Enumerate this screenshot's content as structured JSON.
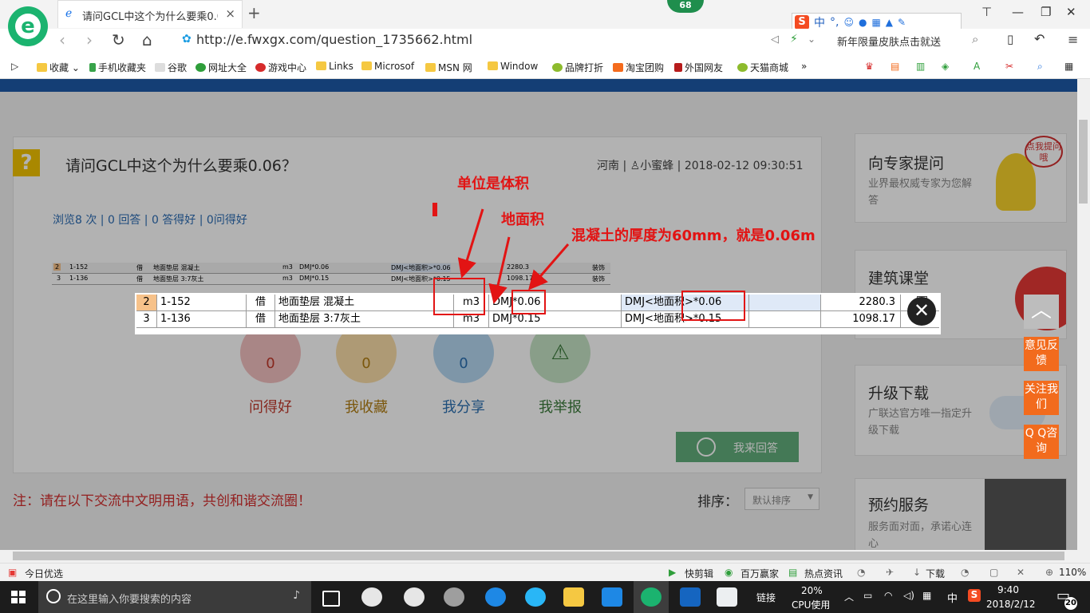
{
  "browser": {
    "tab_title": "请问GCL中这个为什么要乘0.06？",
    "tab_close": "×",
    "new_tab": "+",
    "badge": "68",
    "url": "http://e.fwxgx.com/question_1735662.html",
    "promo": "新年限量皮肤点击就送",
    "sogou_labels": [
      "中",
      "°,"
    ],
    "bookmarks": [
      "收藏",
      "手机收藏夹",
      "谷歌",
      "网址大全",
      "游戏中心",
      "Links",
      "Microsof",
      "MSN 网",
      "Window",
      "品牌打折",
      "淘宝团购",
      "外国网友",
      "天猫商城"
    ],
    "more": "»"
  },
  "question": {
    "title": "请问GCL中这个为什么要乘0.06？",
    "region": "河南",
    "user": "小蜜蜂",
    "date": "2018-02-12 09:30:51",
    "stats": "浏览8 次 | 0 回答 | 0 答得好 | 0问得好",
    "actions": [
      {
        "count": "0",
        "label": "问得好",
        "color": "#e57373"
      },
      {
        "count": "0",
        "label": "我收藏",
        "color": "#f2b33d"
      },
      {
        "count": "0",
        "label": "我分享",
        "color": "#5aa7e0"
      },
      {
        "count": "",
        "label": "我举报",
        "color": "#7fbf7f"
      }
    ],
    "answer_button": "我来回答",
    "notice": "注：请在以下交流中文明用语，共创和谐交流圈！",
    "sort_label": "排序：",
    "sort_value": "默认排序"
  },
  "sidebar": {
    "cards": [
      {
        "title": "向专家提问",
        "sub": "业界最权威专家为您解答"
      },
      {
        "title": "建筑课堂",
        "sub": ""
      },
      {
        "title": "升级下载",
        "sub": "广联达官方唯一指定升级下载"
      },
      {
        "title": "预约服务",
        "sub": "服务面对面，承诺心连心"
      }
    ],
    "bubble": "点我提问哦",
    "feedback": "意见反馈",
    "follow": "关注我们",
    "qq": "Q Q咨询"
  },
  "table_rows": [
    {
      "no": "2",
      "code": "1-152",
      "type": "借",
      "name": "地面垫层 混凝土",
      "unit": "m3",
      "formula": "DMJ*0.06",
      "expr": "DMJ<地面积>*0.06",
      "qty": "2280.3"
    },
    {
      "no": "3",
      "code": "1-136",
      "type": "借",
      "name": "地面垫层 3:7灰土",
      "unit": "m3",
      "formula": "DMJ*0.15",
      "expr": "DMJ<地面积>*0.15",
      "qty": "1098.17"
    }
  ],
  "small_rows": [
    {
      "no": "2",
      "code": "1-152",
      "type": "借",
      "name": "地面垫层 混凝土",
      "unit": "m3",
      "formula": "DMJ*0.06",
      "expr": "DMJ<地面积>*0.06",
      "qty": "2280.3",
      "tag": "装饰"
    },
    {
      "no": "3",
      "code": "1-136",
      "type": "借",
      "name": "地面垫层 3:7灰土",
      "unit": "m3",
      "formula": "DMJ*0.15",
      "expr": "DMJ<地面积>*0.15",
      "qty": "1098.17",
      "tag": "装饰"
    }
  ],
  "annotations": {
    "unit": "单位是体积",
    "area": "地面积",
    "thickness": "混凝土的厚度为60mm，就是0.06m"
  },
  "statusbar": {
    "left": "今日优选",
    "items": [
      "快剪辑",
      "百万赢家",
      "热点资讯",
      "下载"
    ],
    "zoom": "110%"
  },
  "taskbar": {
    "search_placeholder": "在这里输入你要搜索的内容",
    "link": "链接",
    "cpu": "20%",
    "cpu_label": "CPU使用",
    "ime": "中",
    "time": "9:40",
    "date": "2018/2/12",
    "notif": "20"
  }
}
